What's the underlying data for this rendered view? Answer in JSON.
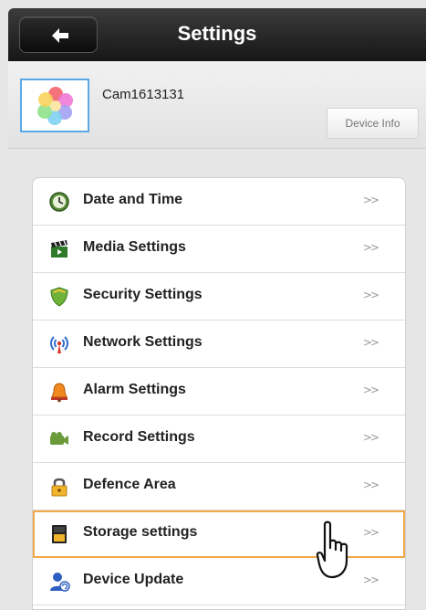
{
  "header": {
    "title": "Settings",
    "back_icon": "back-arrow-icon"
  },
  "device": {
    "name": "Cam1613131",
    "device_info_label": "Device Info",
    "avatar_icon": "flower-app-icon"
  },
  "menu": {
    "items": [
      {
        "label": "Date and Time",
        "icon": "clock-icon",
        "chevron": ">>"
      },
      {
        "label": "Media Settings",
        "icon": "clapperboard-icon",
        "chevron": ">>"
      },
      {
        "label": "Security Settings",
        "icon": "shield-icon",
        "chevron": ">>"
      },
      {
        "label": "Network Settings",
        "icon": "antenna-icon",
        "chevron": ">>"
      },
      {
        "label": "Alarm Settings",
        "icon": "bell-icon",
        "chevron": ">>"
      },
      {
        "label": "Record Settings",
        "icon": "video-camera-icon",
        "chevron": ">>"
      },
      {
        "label": "Defence Area",
        "icon": "lock-icon",
        "chevron": ">>"
      },
      {
        "label": "Storage settings",
        "icon": "sd-card-icon",
        "chevron": ">>",
        "selected": true
      },
      {
        "label": "Device Update",
        "icon": "user-update-icon",
        "chevron": ">>"
      }
    ]
  },
  "colors": {
    "selected_outline": "#f2a94a",
    "avatar_border": "#5aa9e6",
    "topbar": "#1e1e1e"
  }
}
